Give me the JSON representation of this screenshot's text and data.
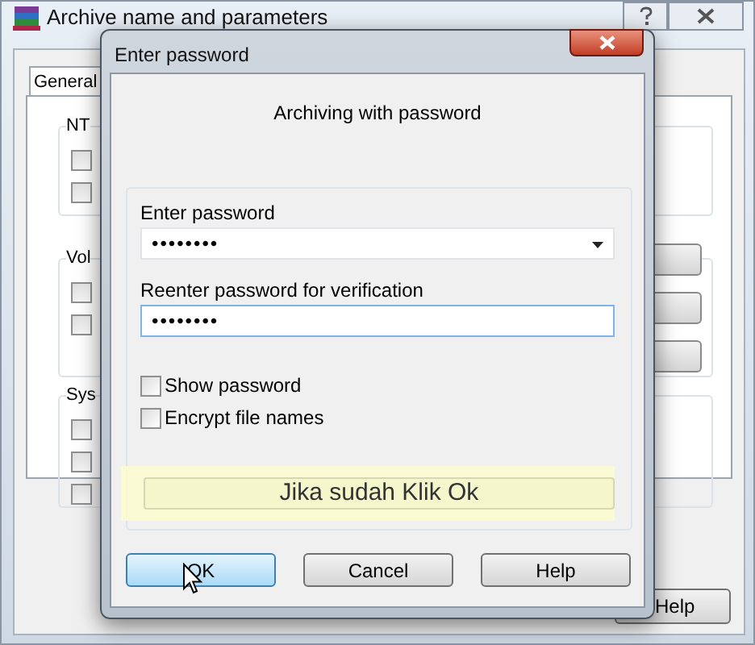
{
  "background_window": {
    "title": "Archive name and parameters",
    "tab": {
      "label": "General",
      "selected": true
    },
    "groups": [
      {
        "label": "NT",
        "checkboxes": [
          {
            "checked": false
          },
          {
            "checked": false
          }
        ]
      },
      {
        "label": "Vol",
        "checkboxes": [
          {
            "checked": false
          },
          {
            "checked": false
          }
        ]
      },
      {
        "label": "Sys",
        "checkboxes": [
          {
            "checked": false
          },
          {
            "checked": false
          },
          {
            "checked": false
          }
        ]
      }
    ],
    "buttons": [
      "Help"
    ]
  },
  "dialog": {
    "title": "Enter password",
    "heading": "Archiving with password",
    "fields": [
      {
        "kind": "combo",
        "label": "Enter password",
        "value": "••••••••",
        "focused": false
      },
      {
        "kind": "text",
        "label": "Reenter password for verification",
        "value": "••••••••",
        "focused": true
      }
    ],
    "options": [
      {
        "label": "Show password",
        "checked": false
      },
      {
        "label": "Encrypt file names",
        "checked": false
      }
    ],
    "annotation": "Jika sudah Klik Ok",
    "buttons": [
      {
        "label": "OK",
        "default": true
      },
      {
        "label": "Cancel",
        "default": false
      },
      {
        "label": "Help",
        "default": false
      }
    ]
  }
}
